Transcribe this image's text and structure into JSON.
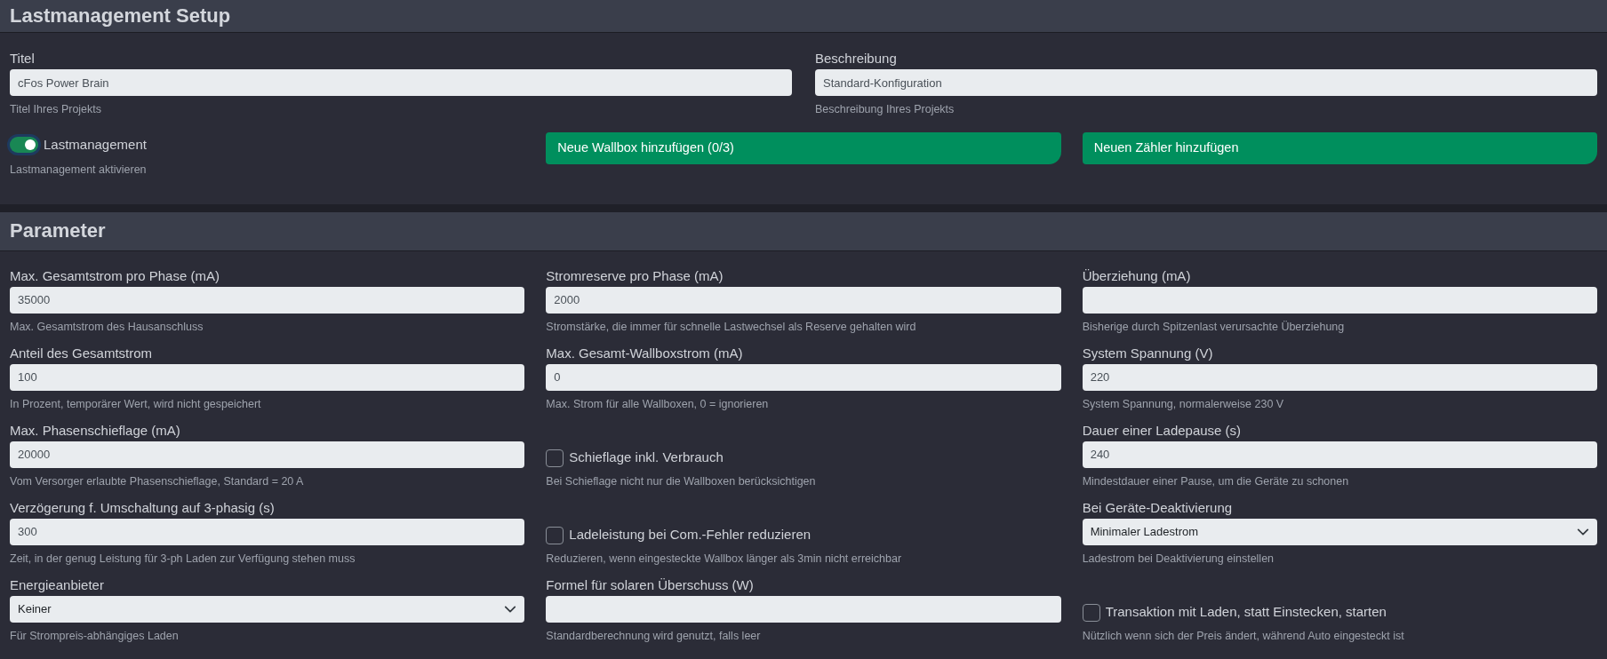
{
  "setup": {
    "title": "Lastmanagement Setup",
    "fields": [
      {
        "label": "Titel",
        "value": "cFos Power Brain",
        "help": "Titel Ihres Projekts"
      },
      {
        "label": "Beschreibung",
        "value": "Standard-Konfiguration",
        "help": "Beschreibung Ihres Projekts"
      }
    ],
    "toggle": {
      "label": "Lastmanagement",
      "on": true,
      "help": "Lastmanagement aktivieren"
    },
    "buttons": [
      "Neue Wallbox hinzufügen (0/3)",
      "Neuen Zähler hinzufügen"
    ]
  },
  "parameters": {
    "title": "Parameter",
    "items": [
      {
        "kind": "text",
        "label": "Max. Gesamtstrom pro Phase (mA)",
        "value": "35000",
        "help": "Max. Gesamtstrom des Hausanschluss"
      },
      {
        "kind": "text",
        "label": "Stromreserve pro Phase (mA)",
        "value": "2000",
        "help": "Stromstärke, die immer für schnelle Lastwechsel als Reserve gehalten wird"
      },
      {
        "kind": "text",
        "label": "Überziehung (mA)",
        "help": "Bisherige durch Spitzenlast verursachte Überziehung"
      },
      {
        "kind": "text",
        "label": "Anteil des Gesamtstrom",
        "value": "100",
        "help": "In Prozent, temporärer Wert, wird nicht gespeichert"
      },
      {
        "kind": "text",
        "label": "Max. Gesamt-Wallboxstrom (mA)",
        "value": "0",
        "help": "Max. Strom für alle Wallboxen, 0 = ignorieren"
      },
      {
        "kind": "text",
        "label": "System Spannung (V)",
        "value": "220",
        "help": "System Spannung, normalerweise 230 V"
      },
      {
        "kind": "text",
        "label": "Max. Phasenschieflage (mA)",
        "value": "20000",
        "help": "Vom Versorger erlaubte Phasenschieflage, Standard = 20 A"
      },
      {
        "kind": "checkbox",
        "label": "Schieflage inkl. Verbrauch",
        "checked": false,
        "help": "Bei Schieflage nicht nur die Wallboxen berücksichtigen"
      },
      {
        "kind": "text",
        "label": "Dauer einer Ladepause (s)",
        "value": "240",
        "help": "Mindestdauer einer Pause, um die Geräte zu schonen"
      },
      {
        "kind": "text",
        "label": "Verzögerung f. Umschaltung auf 3-phasig (s)",
        "value": "300",
        "help": "Zeit, in der genug Leistung für 3-ph Laden zur Verfügung stehen muss"
      },
      {
        "kind": "checkbox",
        "label": "Ladeleistung bei Com.-Fehler reduzieren",
        "checked": false,
        "help": "Reduzieren, wenn eingesteckte Wallbox länger als 3min nicht erreichbar"
      },
      {
        "kind": "select",
        "label": "Bei Geräte-Deaktivierung",
        "value": "Minimaler Ladestrom",
        "help": "Ladestrom bei Deaktivierung einstellen"
      },
      {
        "kind": "select",
        "label": "Energieanbieter",
        "value": "Keiner",
        "help": "Für Strompreis-abhängiges Laden"
      },
      {
        "kind": "text",
        "label": "Formel für solaren Überschuss (W)",
        "help": "Standardberechnung wird genutzt, falls leer"
      },
      {
        "kind": "checkbox",
        "label": "Transaktion mit Laden, statt Einstecken, starten",
        "checked": false,
        "help": "Nützlich wenn sich der Preis ändert, während Auto eingesteckt ist"
      }
    ]
  }
}
